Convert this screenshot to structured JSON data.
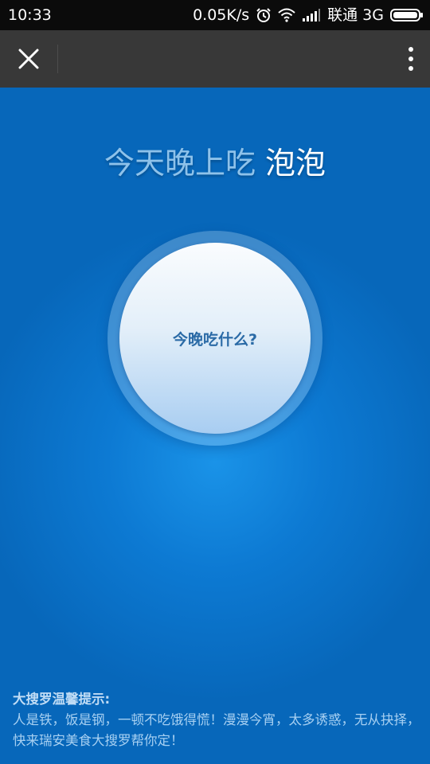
{
  "status_bar": {
    "time": "10:33",
    "network_speed": "0.05K/s",
    "carrier": "联通 3G",
    "icons": [
      "alarm-icon",
      "wifi-icon",
      "signal-icon",
      "battery-icon"
    ]
  },
  "nav_bar": {
    "close_icon": "close-icon",
    "more_icon": "more-vertical-icon"
  },
  "headline": {
    "prefix": "今天晚上吃",
    "dish": "泡泡"
  },
  "spin_button": {
    "label": "今晚吃什么?"
  },
  "tips": {
    "title": "大搜罗温馨提示:",
    "body": "人是铁，饭是钢，一顿不吃饿得慌！漫漫今宵，太多诱惑，无从抉择，快来瑞安美食大搜罗帮你定！"
  },
  "colors": {
    "background": "#0d7ad3",
    "nav_bar": "#383838",
    "status_bar": "#0b0b0b",
    "headline_prefix": "#8ec2ea",
    "button_label": "#2a6aa6"
  }
}
